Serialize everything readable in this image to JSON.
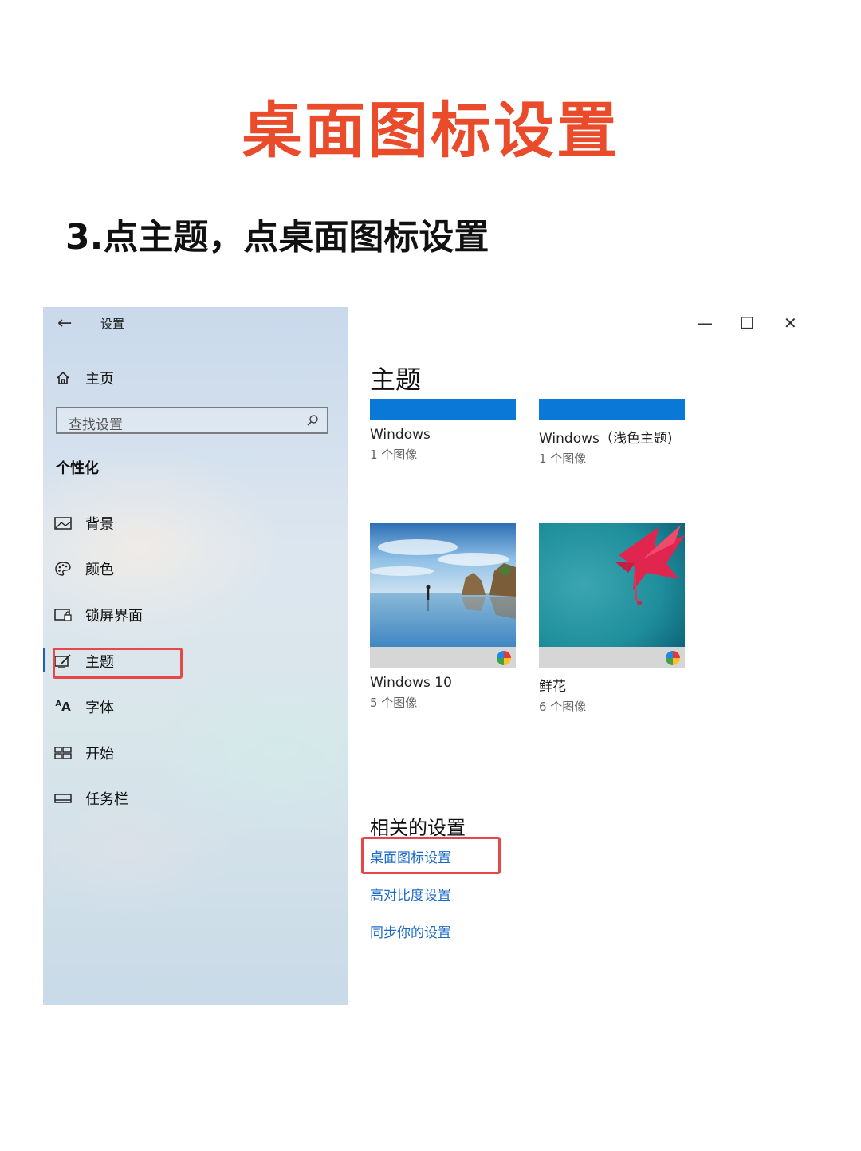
{
  "page": {
    "title": "桌面图标设置",
    "step": "3.点主题，点桌面图标设置"
  },
  "window": {
    "title": "设置",
    "controls": {
      "minimize": "—",
      "maximize": "☐",
      "close": "✕"
    }
  },
  "sidebar": {
    "home": "主页",
    "search_placeholder": "查找设置",
    "section": "个性化",
    "items": [
      {
        "label": "背景",
        "icon": "image-icon"
      },
      {
        "label": "颜色",
        "icon": "palette-icon"
      },
      {
        "label": "锁屏界面",
        "icon": "lock-screen-icon"
      },
      {
        "label": "主题",
        "icon": "theme-brush-icon",
        "active": true
      },
      {
        "label": "字体",
        "icon": "font-icon"
      },
      {
        "label": "开始",
        "icon": "start-icon"
      },
      {
        "label": "任务栏",
        "icon": "taskbar-icon"
      }
    ]
  },
  "content": {
    "title": "主题",
    "themes": [
      {
        "name": "Windows",
        "count": "1 个图像"
      },
      {
        "name": "Windows（浅色主题)",
        "count": "1 个图像"
      },
      {
        "name": "Windows 10",
        "count": "5 个图像"
      },
      {
        "name": "鲜花",
        "count": "6 个图像"
      }
    ],
    "related_title": "相关的设置",
    "links": [
      "桌面图标设置",
      "高对比度设置",
      "同步你的设置"
    ]
  },
  "colors": {
    "accent": "#0a78d7",
    "highlight": "#e8474a",
    "title_red": "#e94b2b",
    "link": "#1a6ac9"
  }
}
